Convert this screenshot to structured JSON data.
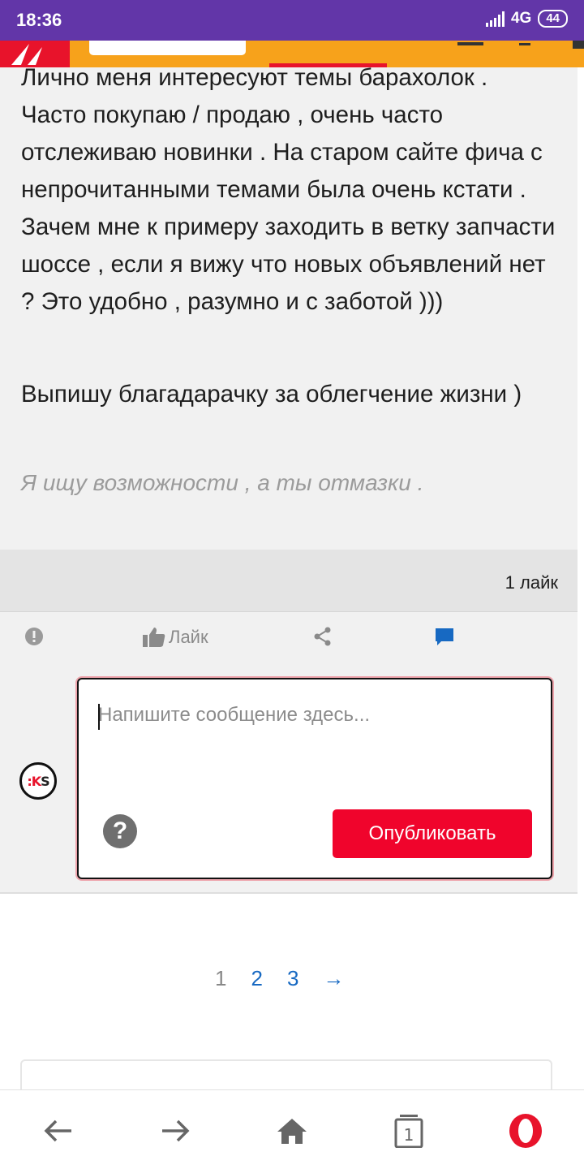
{
  "status_bar": {
    "time": "18:36",
    "network": "4G",
    "battery": "44"
  },
  "post": {
    "paragraph1": "Лично меня интересуют темы барахолок . Часто покупаю / продаю , очень часто отслеживаю новинки . На старом сайте фича с непрочитанными темами была очень кстати . Зачем мне к примеру заходить в ветку запчасти шоссе , если я вижу что новых объявлений нет ? Это удобно , разумно и с заботой )))",
    "paragraph2": "Выпишу благадарачку за облегчение жизни )",
    "signature": "Я ищу возможности , а ты отмазки ."
  },
  "likes": {
    "count_label": "1 лайк"
  },
  "actions": {
    "like_label": "Лайк"
  },
  "reply": {
    "placeholder": "Напишите сообщение здесь...",
    "value": "",
    "avatar_text_left": ":K",
    "avatar_text_right": "S",
    "publish_label": "Опубликовать",
    "help_glyph": "?"
  },
  "pagination": {
    "current": "1",
    "pages": [
      "2",
      "3"
    ],
    "next_glyph": "→"
  },
  "bottom_nav": {
    "tabs_count": "1"
  },
  "colors": {
    "status_bar": "#6236a8",
    "header": "#f7a21b",
    "brand_red": "#e8132b",
    "publish_button": "#f0042c",
    "link_blue": "#1769c2"
  }
}
